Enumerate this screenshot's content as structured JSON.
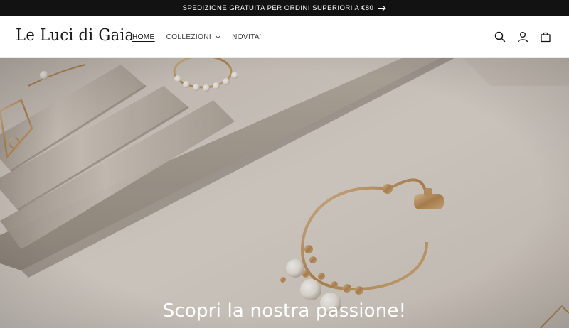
{
  "announcement": {
    "text": "SPEDIZIONE GRATUITA PER ORDINI SUPERIORI A €80",
    "arrow_icon": "arrow-right-icon"
  },
  "header": {
    "logo_text": "Le Luci di Gaia",
    "nav": [
      {
        "label": "HOME",
        "active": true
      },
      {
        "label": "COLLEZIONI",
        "has_dropdown": true
      },
      {
        "label": "NOVITA'"
      }
    ],
    "icons": [
      "search-icon",
      "account-icon",
      "cart-icon"
    ]
  },
  "hero": {
    "title": "Scopri la nostra passione!",
    "colors": {
      "overlay_text": "#ffffff",
      "velvet": "#d9d2ca"
    }
  }
}
